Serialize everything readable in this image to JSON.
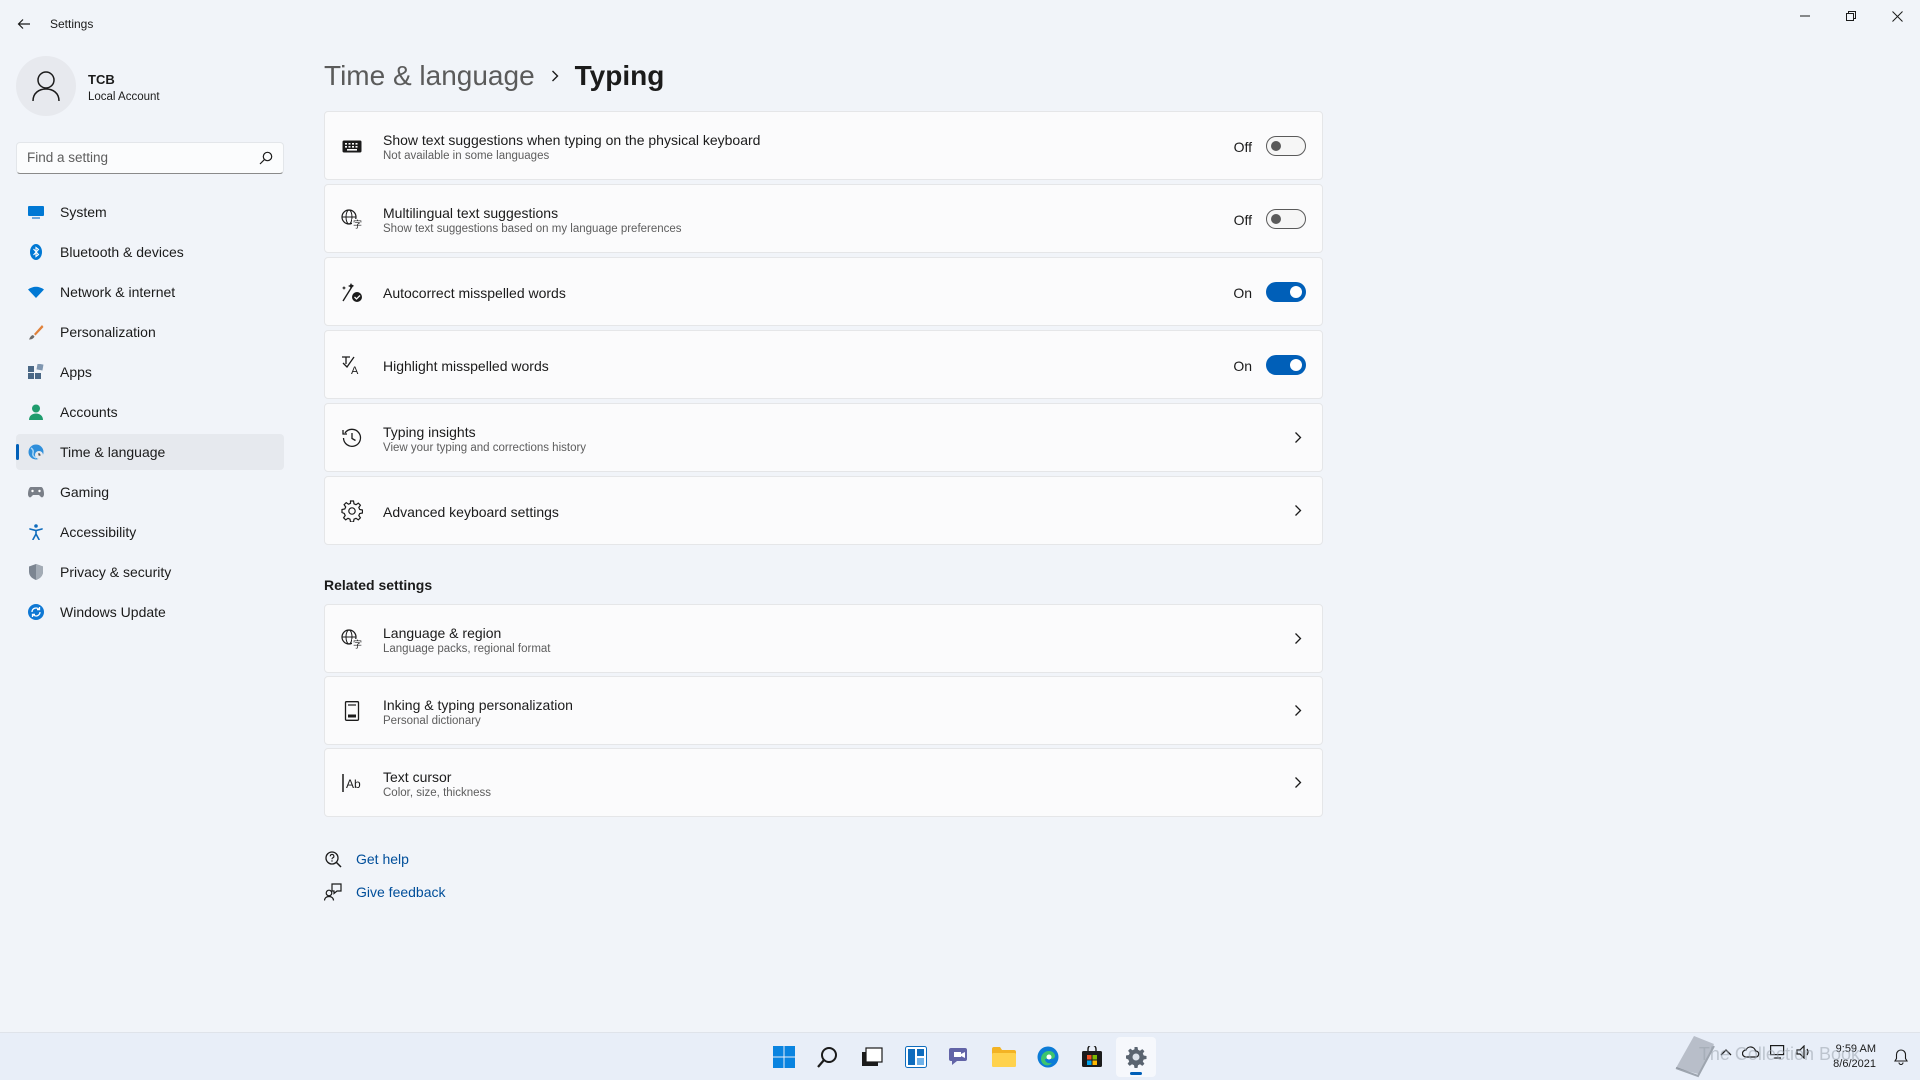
{
  "window": {
    "title": "Settings"
  },
  "profile": {
    "name": "TCB",
    "account_type": "Local Account"
  },
  "search": {
    "placeholder": "Find a setting"
  },
  "sidebar": {
    "items": [
      {
        "label": "System",
        "icon": "monitor-icon",
        "active": false
      },
      {
        "label": "Bluetooth & devices",
        "icon": "bluetooth-icon",
        "active": false
      },
      {
        "label": "Network & internet",
        "icon": "wifi-icon",
        "active": false
      },
      {
        "label": "Personalization",
        "icon": "brush-icon",
        "active": false
      },
      {
        "label": "Apps",
        "icon": "apps-icon",
        "active": false
      },
      {
        "label": "Accounts",
        "icon": "person-icon",
        "active": false
      },
      {
        "label": "Time & language",
        "icon": "globe-clock-icon",
        "active": true
      },
      {
        "label": "Gaming",
        "icon": "gamepad-icon",
        "active": false
      },
      {
        "label": "Accessibility",
        "icon": "accessibility-icon",
        "active": false
      },
      {
        "label": "Privacy & security",
        "icon": "shield-icon",
        "active": false
      },
      {
        "label": "Windows Update",
        "icon": "update-icon",
        "active": false
      }
    ]
  },
  "breadcrumb": {
    "parent": "Time & language",
    "current": "Typing"
  },
  "settings": [
    {
      "title": "Show text suggestions when typing on the physical keyboard",
      "subtitle": "Not available in some languages",
      "state": "Off",
      "icon": "keyboard-icon"
    },
    {
      "title": "Multilingual text suggestions",
      "subtitle": "Show text suggestions based on my language preferences",
      "state": "Off",
      "icon": "language-icon"
    },
    {
      "title": "Autocorrect misspelled words",
      "subtitle": "",
      "state": "On",
      "icon": "autocorrect-icon"
    },
    {
      "title": "Highlight misspelled words",
      "subtitle": "",
      "state": "On",
      "icon": "highlight-spelling-icon"
    },
    {
      "title": "Typing insights",
      "subtitle": "View your typing and corrections history",
      "icon": "history-icon"
    },
    {
      "title": "Advanced keyboard settings",
      "subtitle": "",
      "icon": "gear-icon"
    }
  ],
  "related": {
    "heading": "Related settings",
    "items": [
      {
        "title": "Language & region",
        "subtitle": "Language packs, regional format",
        "icon": "language-region-icon"
      },
      {
        "title": "Inking & typing personalization",
        "subtitle": "Personal dictionary",
        "icon": "notebook-icon"
      },
      {
        "title": "Text cursor",
        "subtitle": "Color, size, thickness",
        "icon": "text-cursor-icon"
      }
    ]
  },
  "help": {
    "get_help": "Get help",
    "give_feedback": "Give feedback"
  },
  "taskbar": {
    "time": "9:59 AM",
    "date": "8/6/2021",
    "watermark": "The Collection Book",
    "accent": "#005fb8"
  }
}
